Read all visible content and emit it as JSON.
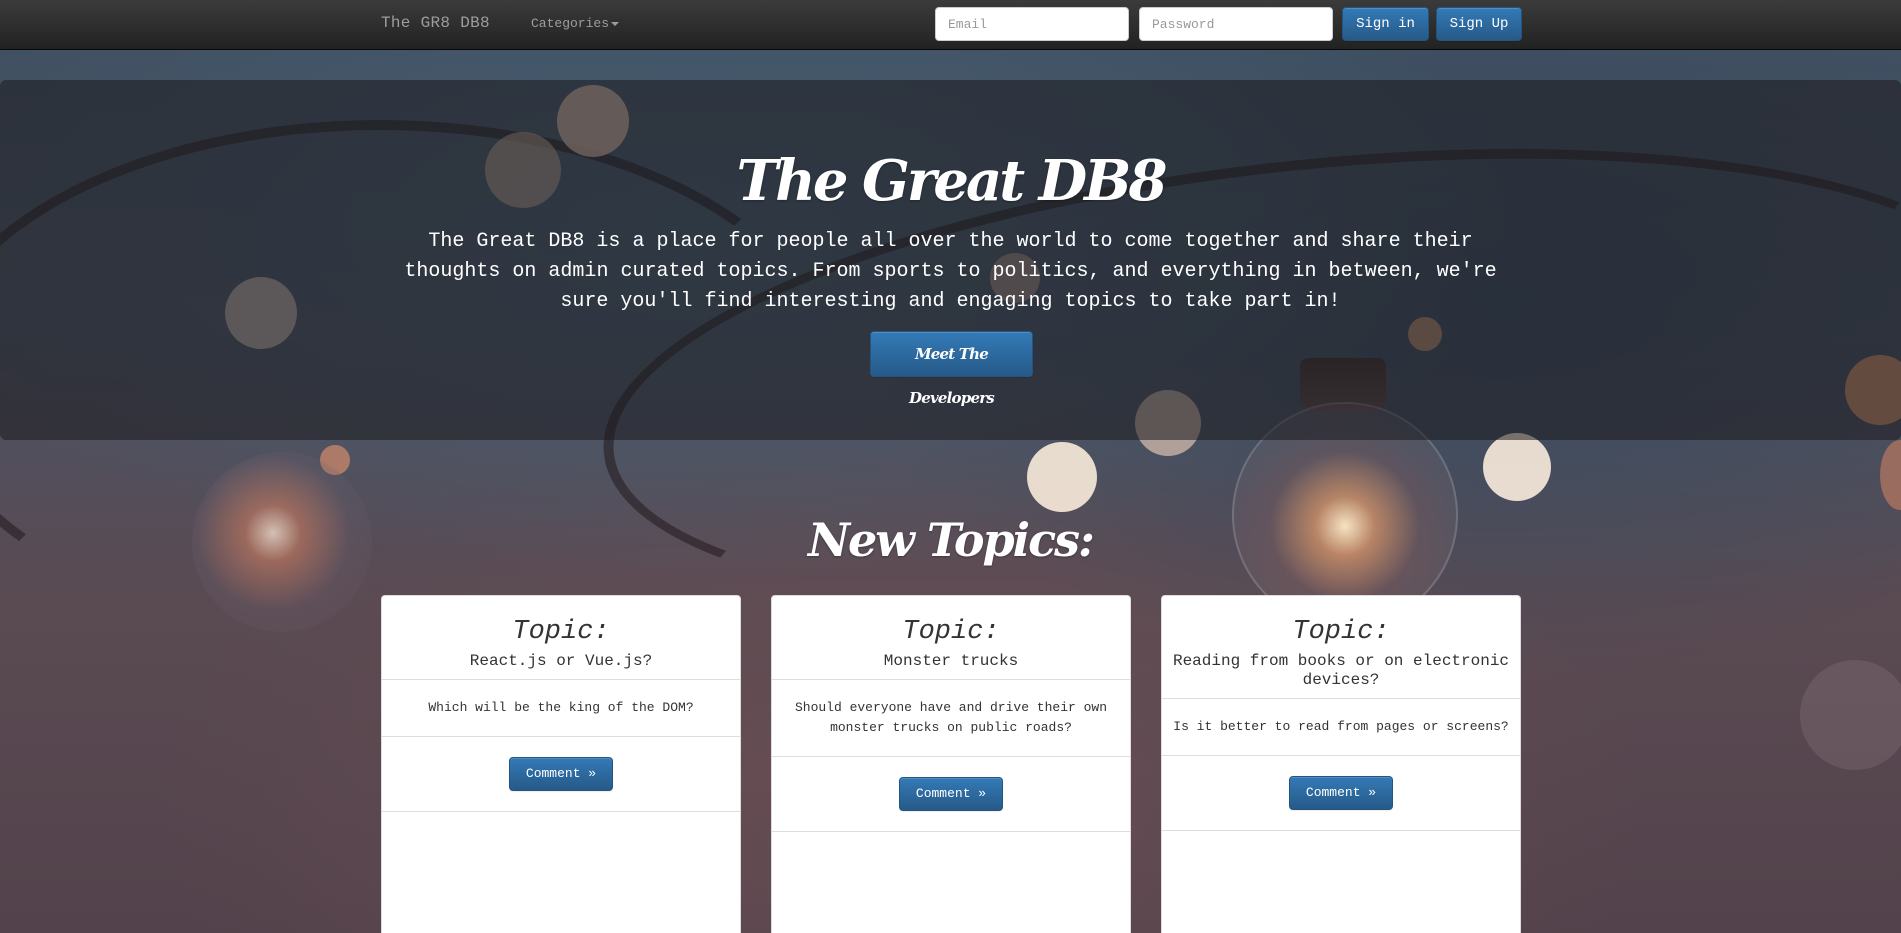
{
  "navbar": {
    "brand": "The GR8 DB8",
    "categories_label": "Categories",
    "email_placeholder": "Email",
    "password_placeholder": "Password",
    "signin_label": "Sign in",
    "signup_label": "Sign Up"
  },
  "hero": {
    "title": "The Great DB8",
    "description": "The Great DB8 is a place for people all over the world to come together and share their thoughts on admin curated topics. From sports to politics, and everything in between, we're sure you'll find interesting and engaging topics to take part in!",
    "button_label": "Meet The Developers"
  },
  "topics_section": {
    "title": "New Topics:",
    "cards": [
      {
        "label": "Topic:",
        "topic": "React.js or Vue.js?",
        "question": "Which will be the king of the DOM?",
        "button_label": "Comment »"
      },
      {
        "label": "Topic:",
        "topic": "Monster trucks",
        "question": "Should everyone have and drive their own monster trucks on public roads?",
        "button_label": "Comment »"
      },
      {
        "label": "Topic:",
        "topic": "Reading from books or on electronic devices?",
        "question": "Is it better to read from pages or screens?",
        "button_label": "Comment »"
      }
    ]
  },
  "colors": {
    "navbar": "#222222",
    "primary_button": "#337ab7",
    "card_background": "#ffffff"
  }
}
